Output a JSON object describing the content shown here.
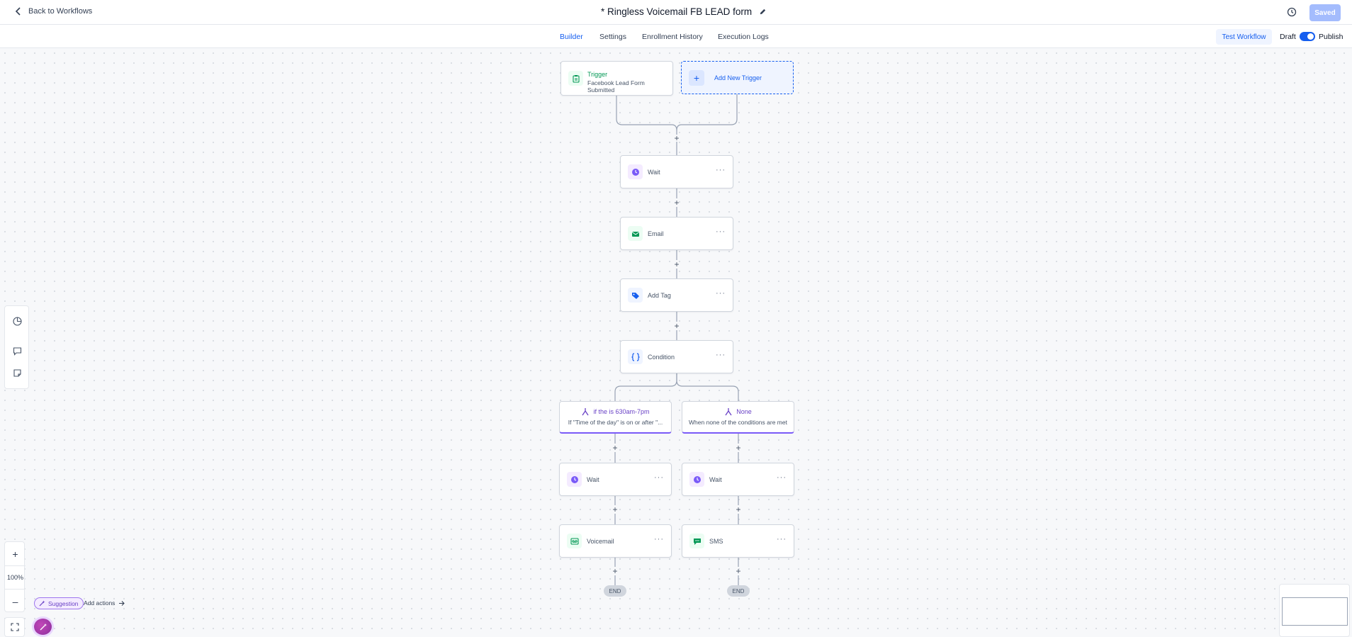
{
  "header": {
    "back_label": "Back to Workflows",
    "title": "* Ringless Voicemail FB LEAD form",
    "saved_label": "Saved"
  },
  "tabs": [
    {
      "label": "Builder",
      "active": true
    },
    {
      "label": "Settings",
      "active": false
    },
    {
      "label": "Enrollment History",
      "active": false
    },
    {
      "label": "Execution Logs",
      "active": false
    }
  ],
  "actions": {
    "test_label": "Test Workflow",
    "draft_label": "Draft",
    "publish_label": "Publish",
    "publish_toggle_on": true
  },
  "trigger": {
    "title": "Trigger",
    "subtitle": "Facebook Lead Form Submitted",
    "add_label": "Add New Trigger"
  },
  "steps": [
    {
      "label": "Wait",
      "icon": "clock-icon"
    },
    {
      "label": "Email",
      "icon": "email-icon"
    },
    {
      "label": "Add Tag",
      "icon": "tag-icon"
    },
    {
      "label": "Condition",
      "icon": "braces-icon"
    }
  ],
  "branches": [
    {
      "title": "if the is 630am-7pm",
      "subtitle": "If \"Time of the day\" is on or after \"...",
      "steps": [
        {
          "label": "Wait",
          "icon": "clock-icon"
        },
        {
          "label": "Voicemail",
          "icon": "voicemail-icon"
        }
      ],
      "end_label": "END"
    },
    {
      "title": "None",
      "subtitle": "When none of the conditions are met",
      "steps": [
        {
          "label": "Wait",
          "icon": "clock-icon"
        },
        {
          "label": "SMS",
          "icon": "sms-icon"
        }
      ],
      "end_label": "END"
    }
  ],
  "zoom": {
    "level": "100%"
  },
  "footer": {
    "suggestion_label": "Suggestion",
    "add_actions_label": "Add actions"
  },
  "colors": {
    "accent": "#155eef",
    "trigger_green": "#039855",
    "branch_purple": "#6941c6"
  }
}
